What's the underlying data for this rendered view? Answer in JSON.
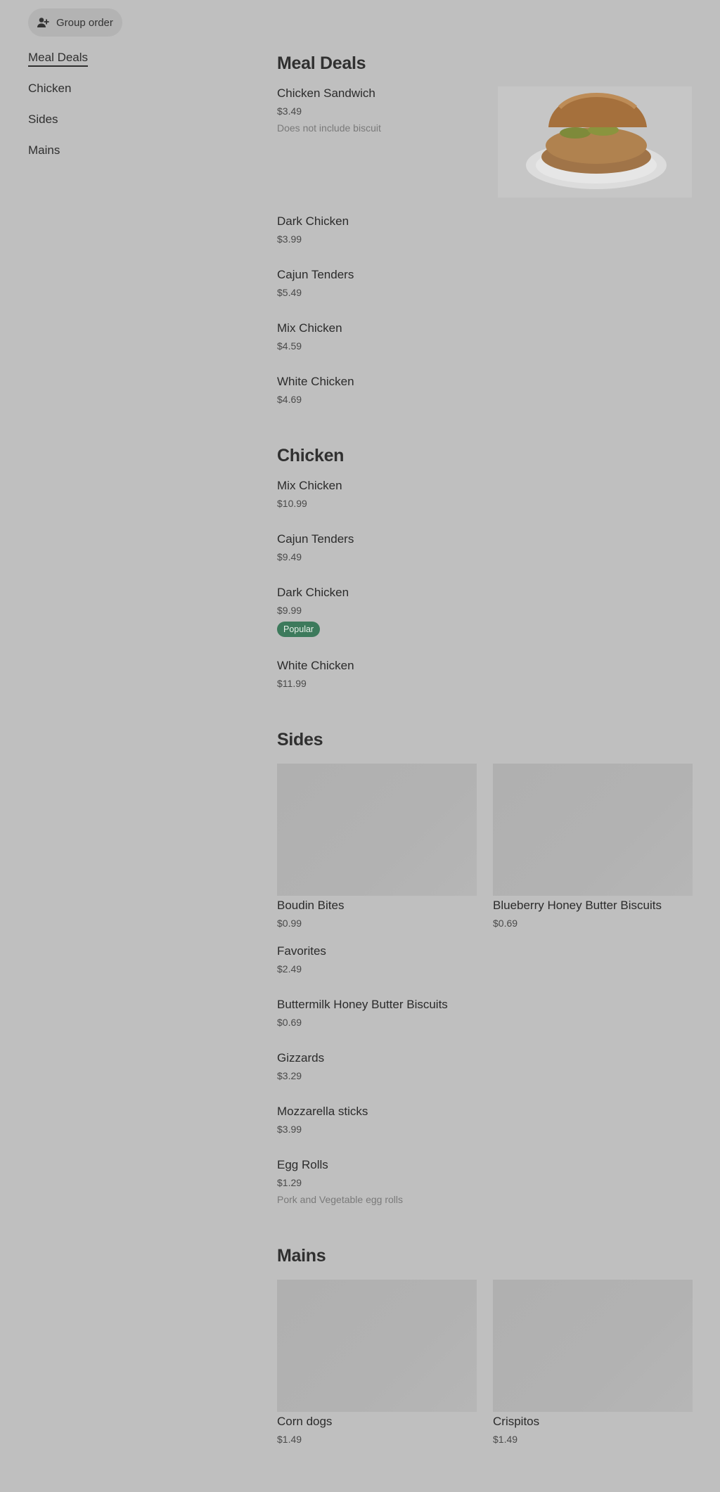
{
  "header": {
    "group_order_label": "Group order",
    "group_order_icon": "add-person-icon"
  },
  "sidebar": {
    "items": [
      {
        "label": "Meal Deals",
        "active": true
      },
      {
        "label": "Chicken"
      },
      {
        "label": "Sides"
      },
      {
        "label": "Mains"
      }
    ]
  },
  "sections": {
    "meal_deals": {
      "title": "Meal Deals",
      "items": [
        {
          "name": "Chicken Sandwich",
          "price": "$3.49",
          "description": "Does not include biscuit"
        },
        {
          "name": "Dark Chicken",
          "price": "$3.99"
        },
        {
          "name": "Cajun Tenders",
          "price": "$5.49"
        },
        {
          "name": "Mix Chicken",
          "price": "$4.59"
        },
        {
          "name": "White Chicken",
          "price": "$4.69"
        }
      ]
    },
    "chicken": {
      "title": "Chicken",
      "items": [
        {
          "name": "Mix Chicken",
          "price": "$10.99"
        },
        {
          "name": "Cajun Tenders",
          "price": "$9.49"
        },
        {
          "name": "Dark Chicken",
          "price": "$9.99",
          "badge": "Popular"
        },
        {
          "name": "White Chicken",
          "price": "$11.99"
        }
      ]
    },
    "sides": {
      "title": "Sides",
      "cards": [
        {
          "name": "Boudin Bites",
          "price": "$0.99"
        },
        {
          "name": "Blueberry Honey Butter Biscuits",
          "price": "$0.69"
        }
      ],
      "items": [
        {
          "name": "Favorites",
          "price": "$2.49"
        },
        {
          "name": "Buttermilk Honey Butter Biscuits",
          "price": "$0.69"
        },
        {
          "name": "Gizzards",
          "price": "$3.29"
        },
        {
          "name": "Mozzarella sticks",
          "price": "$3.99"
        },
        {
          "name": "Egg Rolls",
          "price": "$1.29",
          "description": "Pork and Vegetable egg rolls"
        }
      ]
    },
    "mains": {
      "title": "Mains",
      "cards": [
        {
          "name": "Corn dogs",
          "price": "$1.49"
        },
        {
          "name": "Crispitos",
          "price": "$1.49"
        }
      ]
    }
  },
  "colors": {
    "background": "#bfbfbf",
    "badge": "#3d7a5c"
  }
}
